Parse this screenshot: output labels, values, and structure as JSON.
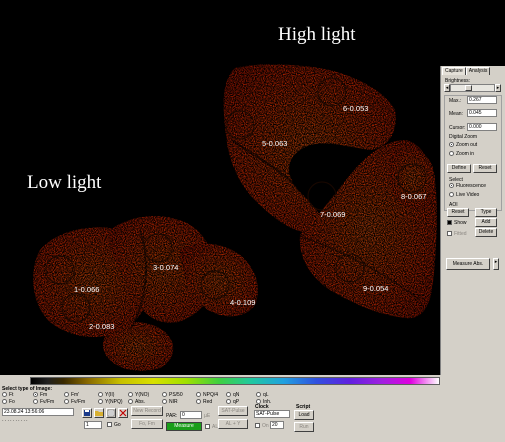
{
  "image": {
    "label_high": "High light",
    "label_low": "Low light",
    "aoi_labels": [
      "1-0.066",
      "2-0.083",
      "3-0.074",
      "4-0.109",
      "5-0.063",
      "6-0.053",
      "7-0.069",
      "8-0.067",
      "9-0.054"
    ]
  },
  "right_panel": {
    "tabs": [
      "Capture",
      "Analysis"
    ],
    "brightness_label": "Brightness:",
    "brightness_level": 0.4,
    "max_label": "Max.:",
    "max_value": "0.267",
    "mean_label": "Mean:",
    "mean_value": "0.045",
    "cursor_label": "Cursor:",
    "cursor_value": "0.000",
    "digital_zoom_label": "Digital Zoom",
    "zoom_out_label": "Zoom out",
    "zoom_in_label": "Zoom in",
    "define_label": "Define",
    "reset_label": "Reset",
    "select_label": "Select",
    "fluorescence_label": "Fluorescence",
    "live_video_label": "Live Video",
    "aoi_label": "AOI",
    "aoi_reset_label": "Reset",
    "type_label": "Type",
    "show_label": "Show",
    "add_label": "Add",
    "fitted_label": "Fitted",
    "delete_label": "Delete",
    "measure_label": "Measure Abs."
  },
  "bottom_panel": {
    "select_type_label": "Select type of Image:",
    "types_row1": [
      "Ft",
      "Fm",
      "Fm'",
      "Y(II)",
      "Y(NO)",
      "PS/50",
      "NPQ/4",
      "qN",
      "qL"
    ],
    "types_row2": [
      "Fo",
      "Fv/Fm",
      "Fv/Fm",
      "Y(NPQ)",
      "Abs.",
      "NIR",
      "Red",
      "qP",
      "Inh."
    ],
    "date_value": "23.08.24 13:56:06",
    "counter_value": "1",
    "go_label": "Go",
    "new_record_label": "New Record",
    "par_label": "PAR:",
    "par_value": "0",
    "fo_fm_label": "Fo, Fm",
    "measure_label": "Measure",
    "ac_label": "AL",
    "sat_pulse_label": "SAT-Pulse",
    "al_y_label": "AL + Y",
    "clock_label": "Clock",
    "clock_value": "SAT-Pulse",
    "on_label": "On",
    "interval_value": "20",
    "script_label": "Script",
    "load_label": "Load",
    "run_label": "Run"
  },
  "colors": {
    "background": "#000000",
    "signal": "#ff3a00",
    "panel": "#d4d0c8",
    "measure": "#1a9e1a"
  }
}
